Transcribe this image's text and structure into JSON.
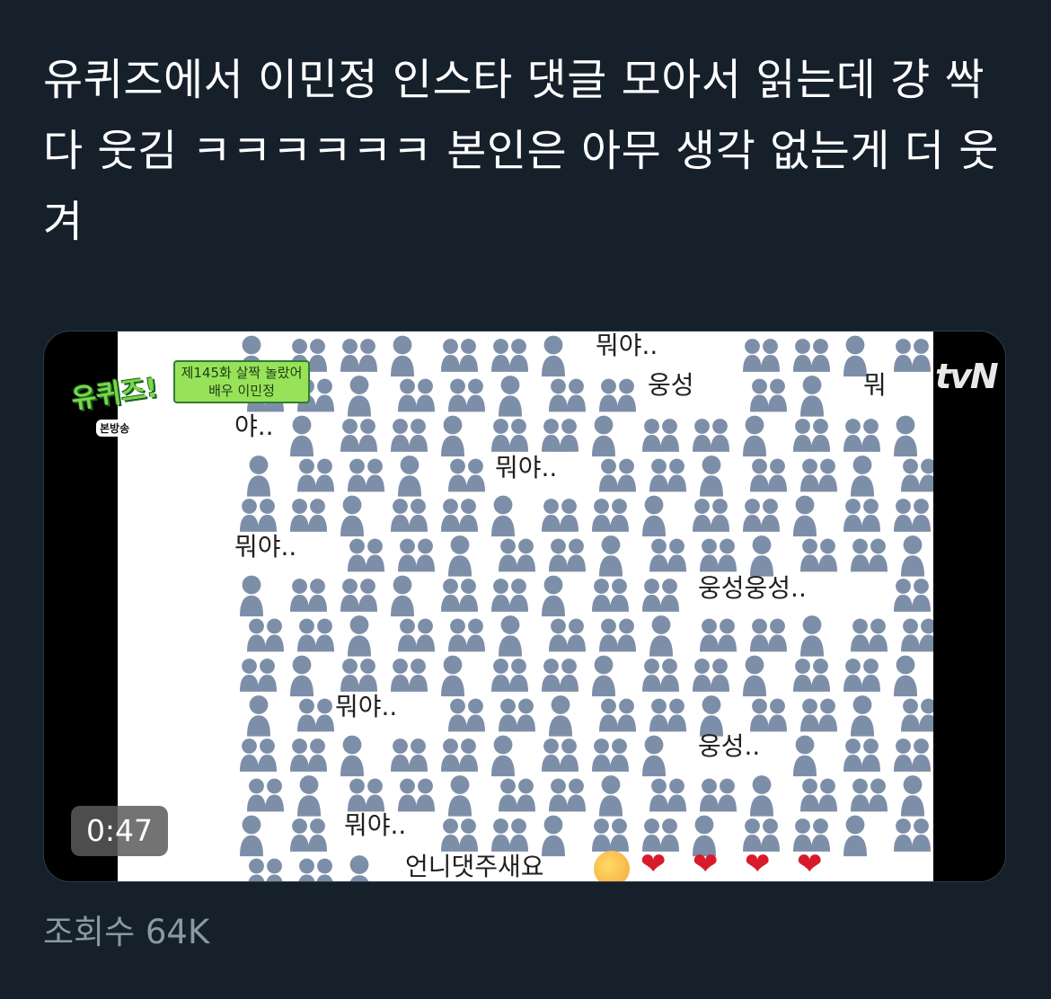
{
  "tweet": {
    "text": "유퀴즈에서 이민정 인스타 댓글 모아서 읽는데 걍 싹 다 웃김 ㅋㅋㅋㅋㅋㅋ 본인은 아무 생각 없는게 더 웃겨"
  },
  "media": {
    "show_logo": "유퀴즈!",
    "episode_badge": "제145화 살짝 놀랐어\n배우 이민정",
    "broadcast_tag": "본방송",
    "channel_logo": "tvN",
    "duration": "0:47",
    "comments": [
      {
        "text": "뭐야..",
        "id": "c1"
      },
      {
        "text": "웅성",
        "id": "c2"
      },
      {
        "text": "뭐",
        "id": "c3"
      },
      {
        "text": "야..",
        "id": "c4"
      },
      {
        "text": "뭐야..",
        "id": "c5"
      },
      {
        "text": "뭐야..",
        "id": "c6"
      },
      {
        "text": "웅성웅성..",
        "id": "c7"
      },
      {
        "text": "뭐야..",
        "id": "c8"
      },
      {
        "text": "웅성..",
        "id": "c9"
      },
      {
        "text": "뭐야..",
        "id": "c10"
      },
      {
        "text": "언니댓주새요",
        "id": "c11"
      }
    ],
    "accent_colors": {
      "person_icon": "#7d8ea8",
      "heart": "#d81b2c"
    }
  },
  "stats": {
    "views": "조회수 64K"
  }
}
